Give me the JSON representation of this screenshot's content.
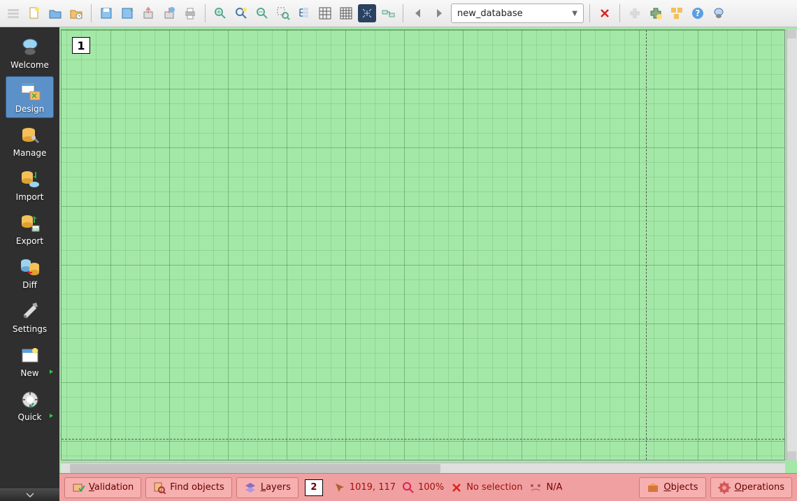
{
  "toolbar": {
    "database_selected": "new_database"
  },
  "sidebar": {
    "items": [
      {
        "label": "Welcome"
      },
      {
        "label": "Design"
      },
      {
        "label": "Manage"
      },
      {
        "label": "Import"
      },
      {
        "label": "Export"
      },
      {
        "label": "Diff"
      },
      {
        "label": "Settings"
      },
      {
        "label": "New"
      },
      {
        "label": "Quick"
      }
    ]
  },
  "canvas": {
    "page_number": "1"
  },
  "status": {
    "validation_label": "Validation",
    "find_objects_label": "Find objects",
    "layers_label": "Layers",
    "box_number": "2",
    "position": "1019, 117",
    "zoom": "100%",
    "selection": "No selection",
    "na": "N/A",
    "objects_label": "Objects",
    "operations_label": "Operations"
  }
}
